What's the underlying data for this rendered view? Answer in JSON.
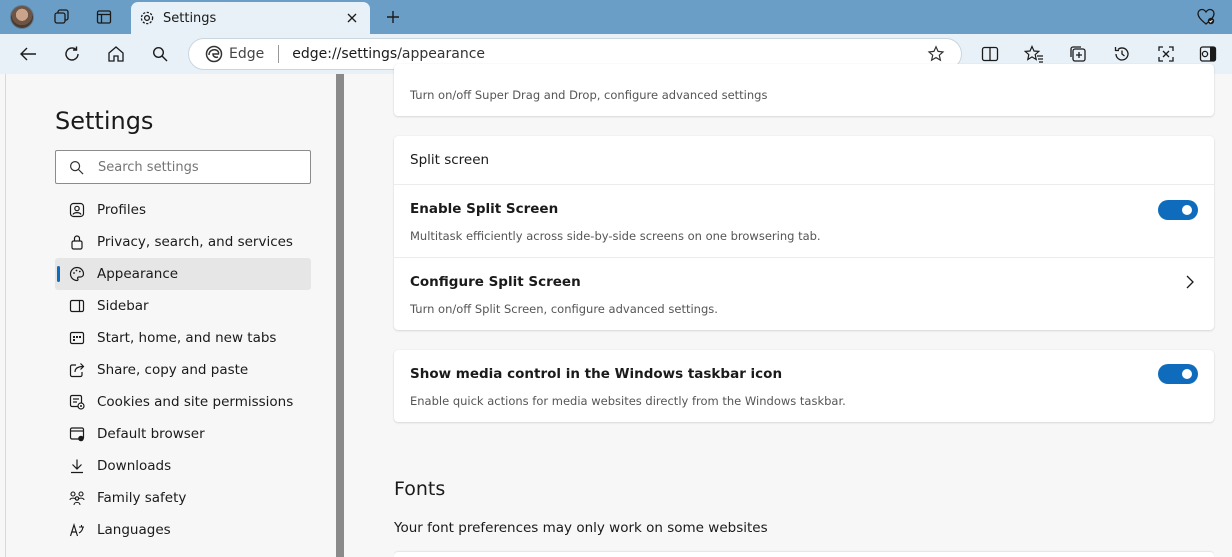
{
  "browser": {
    "tab": {
      "title": "Settings"
    },
    "omnibox": {
      "label": "Edge",
      "url_host": "edge://settings",
      "url_path": "/appearance"
    }
  },
  "sidebar": {
    "title": "Settings",
    "search_placeholder": "Search settings",
    "items": [
      {
        "label": "Profiles",
        "icon": "profile-icon"
      },
      {
        "label": "Privacy, search, and services",
        "icon": "lock-icon"
      },
      {
        "label": "Appearance",
        "icon": "palette-icon",
        "active": true
      },
      {
        "label": "Sidebar",
        "icon": "sidebar-icon"
      },
      {
        "label": "Start, home, and new tabs",
        "icon": "home-tabs-icon"
      },
      {
        "label": "Share, copy and paste",
        "icon": "share-icon"
      },
      {
        "label": "Cookies and site permissions",
        "icon": "cookies-icon"
      },
      {
        "label": "Default browser",
        "icon": "browser-icon"
      },
      {
        "label": "Downloads",
        "icon": "download-icon"
      },
      {
        "label": "Family safety",
        "icon": "family-icon"
      },
      {
        "label": "Languages",
        "icon": "languages-icon"
      }
    ]
  },
  "main": {
    "top_card": {
      "desc": "Turn on/off Super Drag and Drop, configure advanced settings"
    },
    "split_screen": {
      "header": "Split screen",
      "enable_title": "Enable Split Screen",
      "enable_desc": "Multitask efficiently across side-by-side screens on one browsering tab.",
      "enable_on": true,
      "configure_title": "Configure Split Screen",
      "configure_desc": "Turn on/off Split Screen, configure advanced settings."
    },
    "media": {
      "title": "Show media control in the Windows taskbar icon",
      "desc": "Enable quick actions for media websites directly from the Windows taskbar.",
      "on": true
    },
    "fonts": {
      "heading": "Fonts",
      "sub": "Your font preferences may only work on some websites"
    }
  },
  "colors": {
    "accent": "#0f6cbd",
    "tabstrip": "#6b9ec6",
    "toolbar": "#e8f1f8"
  }
}
